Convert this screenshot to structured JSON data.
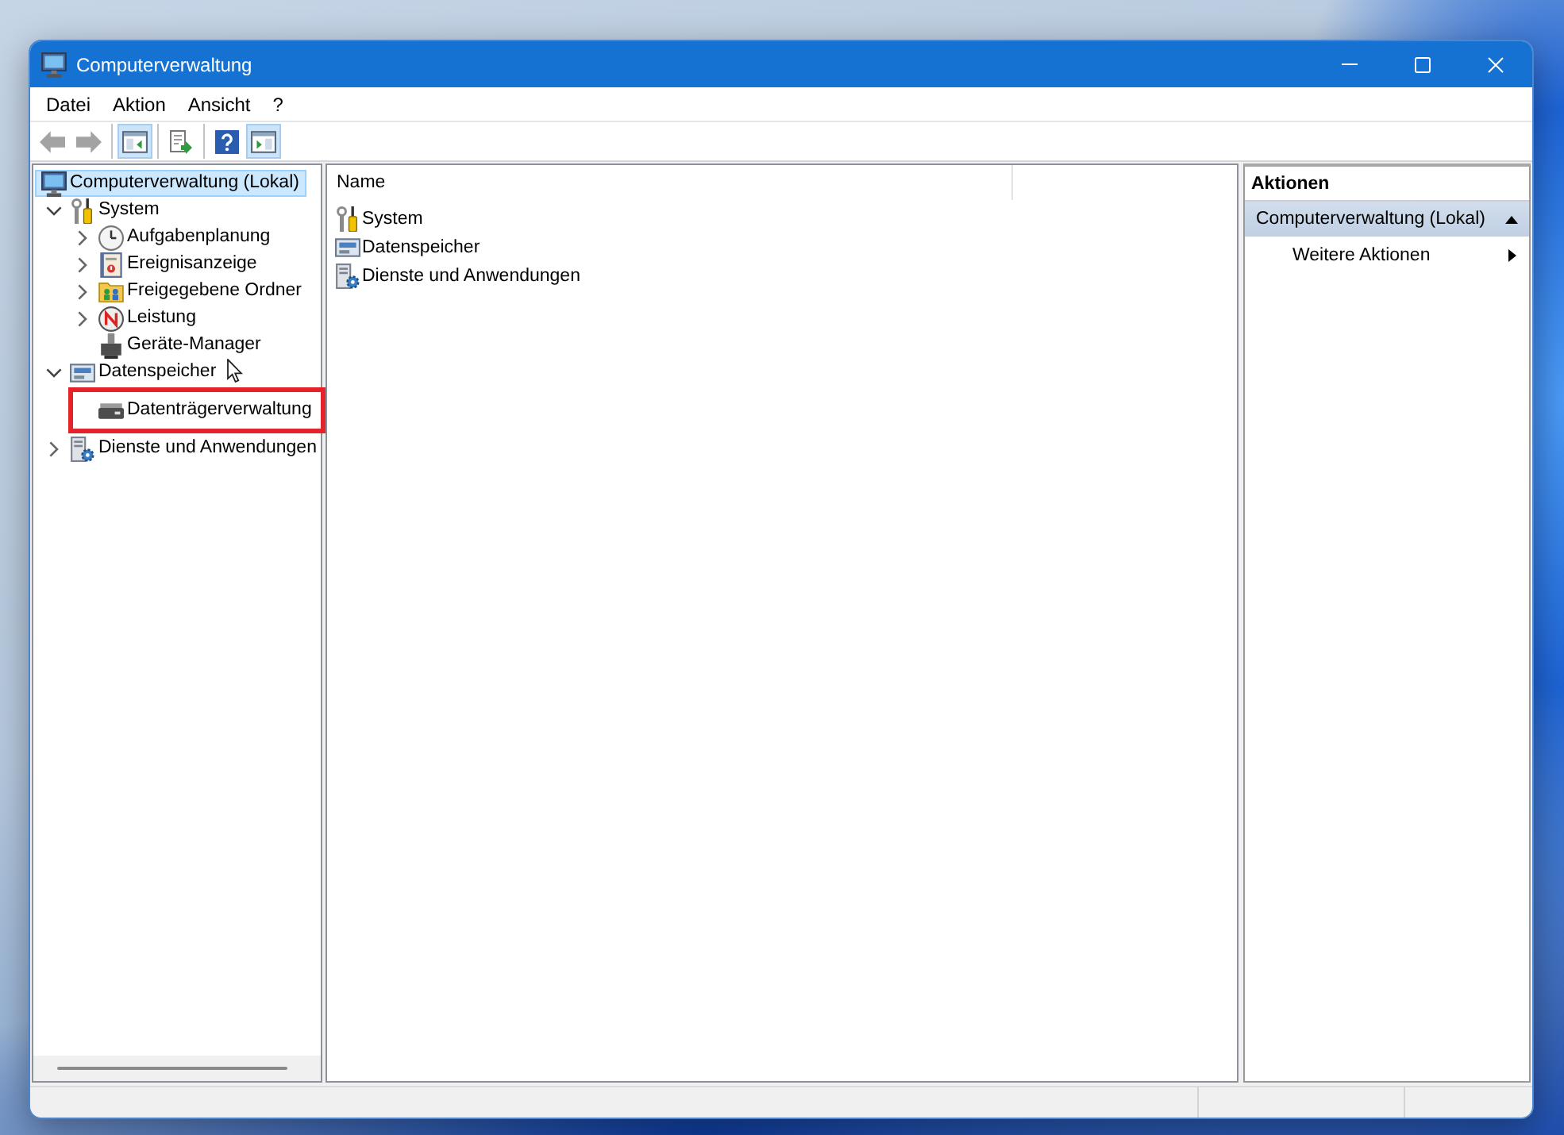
{
  "window": {
    "title": "Computerverwaltung"
  },
  "menu": [
    "Datei",
    "Aktion",
    "Ansicht",
    "?"
  ],
  "toolbar": {
    "groups": [
      [
        {
          "kind": "back",
          "disabled": true,
          "pressed": false
        },
        {
          "kind": "forward",
          "disabled": true,
          "pressed": false
        }
      ],
      [
        {
          "kind": "tree",
          "disabled": false,
          "pressed": true
        }
      ],
      [
        {
          "kind": "export",
          "disabled": false,
          "pressed": false
        }
      ],
      [
        {
          "kind": "help",
          "disabled": false,
          "pressed": false
        },
        {
          "kind": "actions",
          "disabled": false,
          "pressed": true
        }
      ]
    ]
  },
  "tree": [
    {
      "label": "Computerverwaltung (Lokal)",
      "kind": "computer",
      "selected": true,
      "highlighted": false,
      "children": [
        {
          "label": "System",
          "kind": "tools",
          "expanded": true,
          "selected": false,
          "highlighted": false,
          "children": [
            {
              "label": "Aufgabenplanung",
              "kind": "clock",
              "expanded": false,
              "selected": false,
              "highlighted": false
            },
            {
              "label": "Ereignisanzeige",
              "kind": "eventlog",
              "expanded": false,
              "selected": false,
              "highlighted": false
            },
            {
              "label": "Freigegebene Ordner",
              "kind": "sharedfolder",
              "expanded": false,
              "selected": false,
              "highlighted": false
            },
            {
              "label": "Leistung",
              "kind": "performance",
              "expanded": false,
              "selected": false,
              "highlighted": false
            },
            {
              "label": "Geräte-Manager",
              "kind": "devices",
              "selected": false,
              "highlighted": false
            }
          ]
        },
        {
          "label": "Datenspeicher",
          "kind": "storage",
          "expanded": true,
          "selected": false,
          "highlighted": false,
          "children": [
            {
              "label": "Datenträgerverwaltung",
              "kind": "disk",
              "selected": false,
              "highlighted": true
            }
          ]
        },
        {
          "label": "Dienste und Anwendungen",
          "kind": "services",
          "expanded": false,
          "selected": false,
          "highlighted": false
        }
      ]
    }
  ],
  "list": {
    "columns": [
      "Name"
    ],
    "rows": [
      {
        "label": "System",
        "kind": "tools"
      },
      {
        "label": "Datenspeicher",
        "kind": "storage"
      },
      {
        "label": "Dienste und Anwendungen",
        "kind": "services"
      }
    ]
  },
  "actions": {
    "title": "Aktionen",
    "sections": [
      {
        "label": "Computerverwaltung (Lokal)",
        "expanded": true,
        "items": [
          {
            "label": "Weitere Aktionen",
            "kind": "submenu"
          }
        ]
      }
    ]
  }
}
